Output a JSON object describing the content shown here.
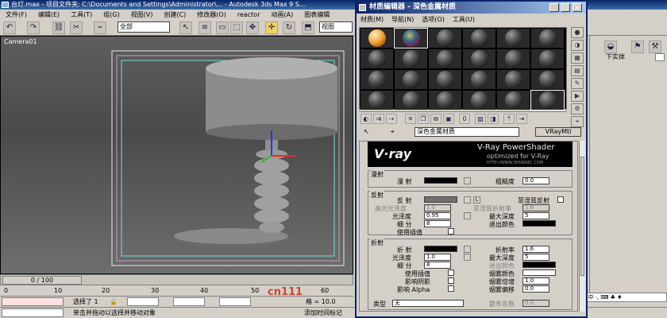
{
  "window": {
    "title": "台灯.max    - 项目文件夹: C:\\Documents and Settings\\Administrator\\...  - Autodesk 3ds Max 9 S..."
  },
  "menu": [
    "文件(F)",
    "编辑(E)",
    "工具(T)",
    "组(G)",
    "视图(V)",
    "创建(C)",
    "修改器(O)",
    "reactor",
    "动画(A)",
    "图表编辑"
  ],
  "toolbar": {
    "selection_filter": "全部",
    "view_label": "视图"
  },
  "viewport": {
    "label": "Camera01"
  },
  "timeline": {
    "slider": "0 / 100",
    "ticks": [
      "0",
      "10",
      "20",
      "30",
      "40",
      "50",
      "60"
    ]
  },
  "status": {
    "selected": "选择了 1",
    "hint": "单击并拖动以选择并移动对象",
    "add_time_tag": "添加时间标记",
    "grid": "格 = 10.0"
  },
  "command_panel": {
    "obj_field": "下实体"
  },
  "material_editor": {
    "title": "材质编辑器  - 深色金属材质",
    "menu": [
      "材质(M)",
      "导航(N)",
      "选项(O)",
      "工具(U)"
    ],
    "material_name": "深色金属材质",
    "material_type": "VRayMtl",
    "vray": {
      "logo": "V·ray",
      "line1": "V-Ray PowerShader",
      "line2": "optimized for V-Ray",
      "line3": "HTTP://WWW.SHUNSEC.COM"
    },
    "diffuse": {
      "group": "漫射",
      "label": "漫 射",
      "roughness_label": "粗糙度",
      "roughness": "0.0"
    },
    "reflection": {
      "group": "反射",
      "reflect_label": "反 射",
      "hilight_label": "高光光泽度",
      "hilight": "1.0",
      "gloss_label": "光泽度",
      "gloss": "0.95",
      "subdivs_label": "细 分",
      "subdivs": "8",
      "interp_label": "使用插值",
      "fresnel_label": "菲涅耳反射",
      "fresnel_ior_label": "菲涅耳折射率",
      "fresnel_ior": "1.6",
      "depth_label": "最大深度",
      "depth": "5",
      "exit_label": "退出颜色",
      "l_btn": "L"
    },
    "refraction": {
      "group": "折射",
      "refract_label": "折 射",
      "gloss_label": "光泽度",
      "gloss": "1.0",
      "subdivs_label": "细 分",
      "subdivs": "8",
      "interp_label": "使用插值",
      "shadow_label": "影响阴影",
      "alpha_label": "影响 Alpha",
      "ior_label": "折射率",
      "ior": "1.6",
      "depth_label": "最大深度",
      "depth": "5",
      "exit_label": "退出颜色",
      "fog_color_label": "烟雾颜色",
      "fog_mult_label": "烟雾倍增",
      "fog_mult": "1.0",
      "fog_bias_label": "烟雾偏移",
      "fog_bias": "0.0",
      "type_label": "类型",
      "type_value": "无",
      "disperse_label": "散布系数",
      "disperse": "0.0"
    }
  },
  "watermark": "cn111",
  "ime": "S中 ·, ⌨ ♣ ♦"
}
